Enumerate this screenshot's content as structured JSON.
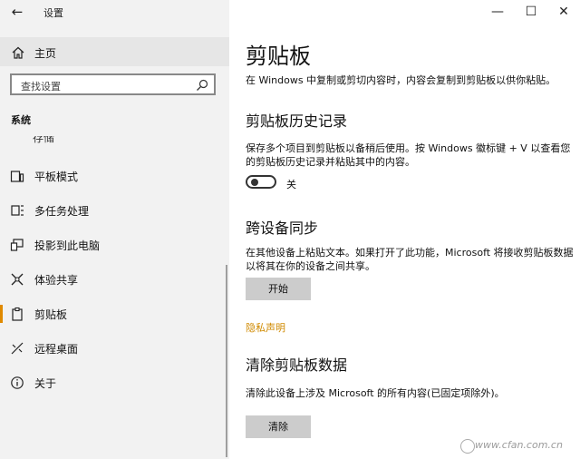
{
  "app": {
    "title": "设置",
    "back_icon": "back-arrow-icon"
  },
  "window_controls": {
    "minimize": "—",
    "maximize": "☐",
    "close": "✕"
  },
  "sidebar": {
    "home_label": "主页",
    "search_placeholder": "查找设置",
    "section_title": "系统",
    "cut_item_label": "存储",
    "items": [
      {
        "label": "平板模式",
        "icon": "tablet-mode-icon",
        "active": false
      },
      {
        "label": "多任务处理",
        "icon": "multitasking-icon",
        "active": false
      },
      {
        "label": "投影到此电脑",
        "icon": "project-to-pc-icon",
        "active": false
      },
      {
        "label": "体验共享",
        "icon": "shared-experiences-icon",
        "active": false
      },
      {
        "label": "剪贴板",
        "icon": "clipboard-icon",
        "active": true
      },
      {
        "label": "远程桌面",
        "icon": "remote-desktop-icon",
        "active": false
      },
      {
        "label": "关于",
        "icon": "info-icon",
        "active": false
      }
    ],
    "accent_color": "#e08a00"
  },
  "main": {
    "title": "剪贴板",
    "intro": "在 Windows 中复制或剪切内容时，内容会复制到剪贴板以供你粘贴。",
    "history": {
      "heading": "剪贴板历史记录",
      "description": "保存多个项目到剪贴板以备稍后使用。按 Windows 徽标键 + V 以查看您的剪贴板历史记录并粘贴其中的内容。",
      "toggle_state": "关",
      "toggle_on": false
    },
    "sync": {
      "heading": "跨设备同步",
      "description": "在其他设备上粘贴文本。如果打开了此功能，Microsoft 将接收剪贴板数据以将其在你的设备之间共享。",
      "button_label": "开始"
    },
    "privacy_link": "隐私声明",
    "clear": {
      "heading": "清除剪贴板数据",
      "description": "清除此设备上涉及 Microsoft 的所有内容(已固定项除外)。",
      "button_label": "清除"
    }
  },
  "watermark": "www.cfan.com.cn"
}
